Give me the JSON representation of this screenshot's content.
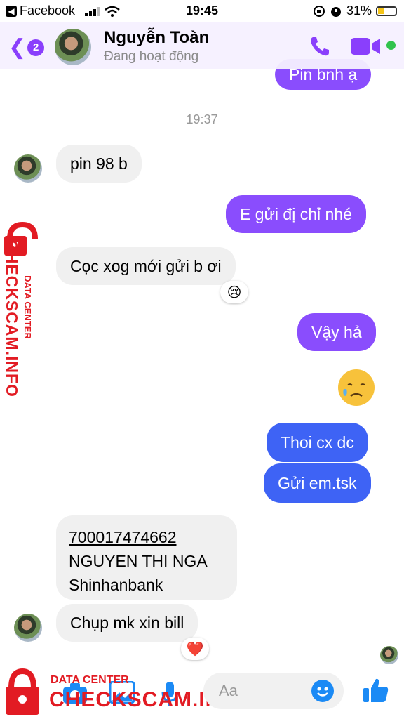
{
  "status_bar": {
    "back_app": "Facebook",
    "time": "19:45",
    "battery": "31%"
  },
  "header": {
    "back_count": "2",
    "name": "Nguyễn Toàn",
    "status": "Đang hoạt động"
  },
  "conversation": {
    "partial_top": "Pin bnh ạ",
    "timestamp": "19:37",
    "messages": [
      {
        "dir": "in",
        "text": "pin 98 b"
      },
      {
        "dir": "out",
        "text": "E gửi đị chỉ nhé"
      },
      {
        "dir": "in",
        "text": "Cọc xog mới gửi b ơi",
        "reaction": "😢"
      },
      {
        "dir": "out",
        "text": "Vậy hả"
      },
      {
        "dir": "out",
        "text": "Thoi cx dc"
      },
      {
        "dir": "out",
        "text": "Gửi em.tsk"
      },
      {
        "dir": "in",
        "text": "Chụp mk xin bill",
        "reaction": "❤️"
      }
    ],
    "bank_card": {
      "account": "700017474662",
      "holder": "NGUYEN THI NGA",
      "bank": "Shinhanbank"
    }
  },
  "composer": {
    "placeholder": "Aa"
  },
  "watermark": {
    "title": "DATA CENTER",
    "site": "CHECKSCAM.INFO"
  },
  "colors": {
    "accent": "#8a3ffc",
    "outgoing": "#8a4dfd",
    "outgoing_blue": "#3e63f5",
    "watermark": "#e21b23"
  }
}
